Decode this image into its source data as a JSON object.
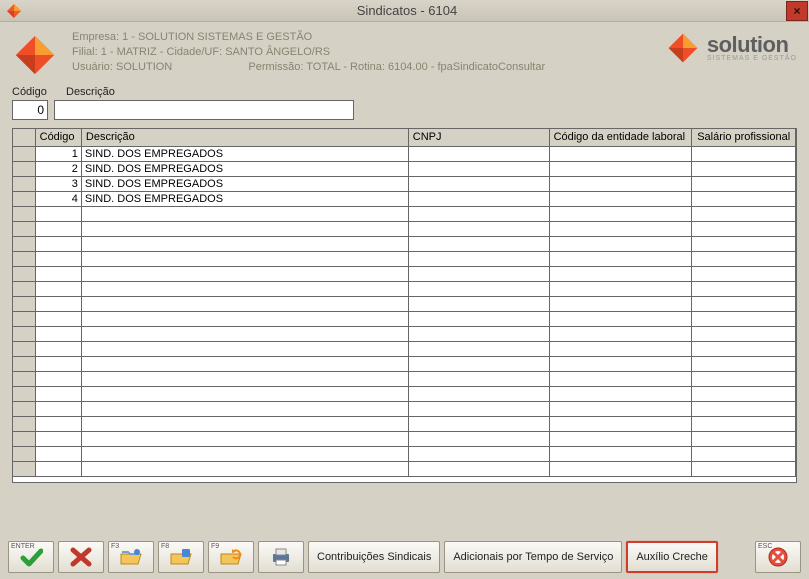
{
  "window": {
    "title": "Sindicatos - 6104"
  },
  "header": {
    "line1": "Empresa: 1 - SOLUTION SISTEMAS E GESTÃO",
    "line2": "Filial: 1 - MATRIZ - Cidade/UF: SANTO ÂNGELO/RS",
    "line3_left": "Usuário: SOLUTION",
    "line3_right": "Permissão: TOTAL - Rotina: 6104.00 - fpaSindicatoConsultar",
    "brand": "solution",
    "tagline": "SISTEMAS E GESTÃO"
  },
  "filter": {
    "codigo_label": "Código",
    "descricao_label": "Descrição",
    "codigo_value": "0",
    "descricao_value": ""
  },
  "table": {
    "columns": {
      "codigo": "Código",
      "descricao": "Descrição",
      "cnpj": "CNPJ",
      "entidade": "Código da entidade laboral",
      "salario": "Salário profissional"
    },
    "rows": [
      {
        "codigo": "1",
        "descricao": "SIND. DOS EMPREGADOS",
        "cnpj": "",
        "entidade": "",
        "salario": ""
      },
      {
        "codigo": "2",
        "descricao": "SIND. DOS EMPREGADOS",
        "cnpj": "",
        "entidade": "",
        "salario": ""
      },
      {
        "codigo": "3",
        "descricao": "SIND. DOS EMPREGADOS",
        "cnpj": "",
        "entidade": "",
        "salario": ""
      },
      {
        "codigo": "4",
        "descricao": "SIND. DOS EMPREGADOS",
        "cnpj": "",
        "entidade": "",
        "salario": ""
      }
    ]
  },
  "footer": {
    "enter_key": "ENTER",
    "f3_key": "F3",
    "f8_key": "F8",
    "f9_key": "F9",
    "esc_key": "ESC",
    "btn_contribuicoes": "Contribuições Sindicais",
    "btn_adicionais": "Adicionais por Tempo de Serviço",
    "btn_creche": "Auxílio Creche"
  },
  "icons": {
    "close": "×"
  }
}
